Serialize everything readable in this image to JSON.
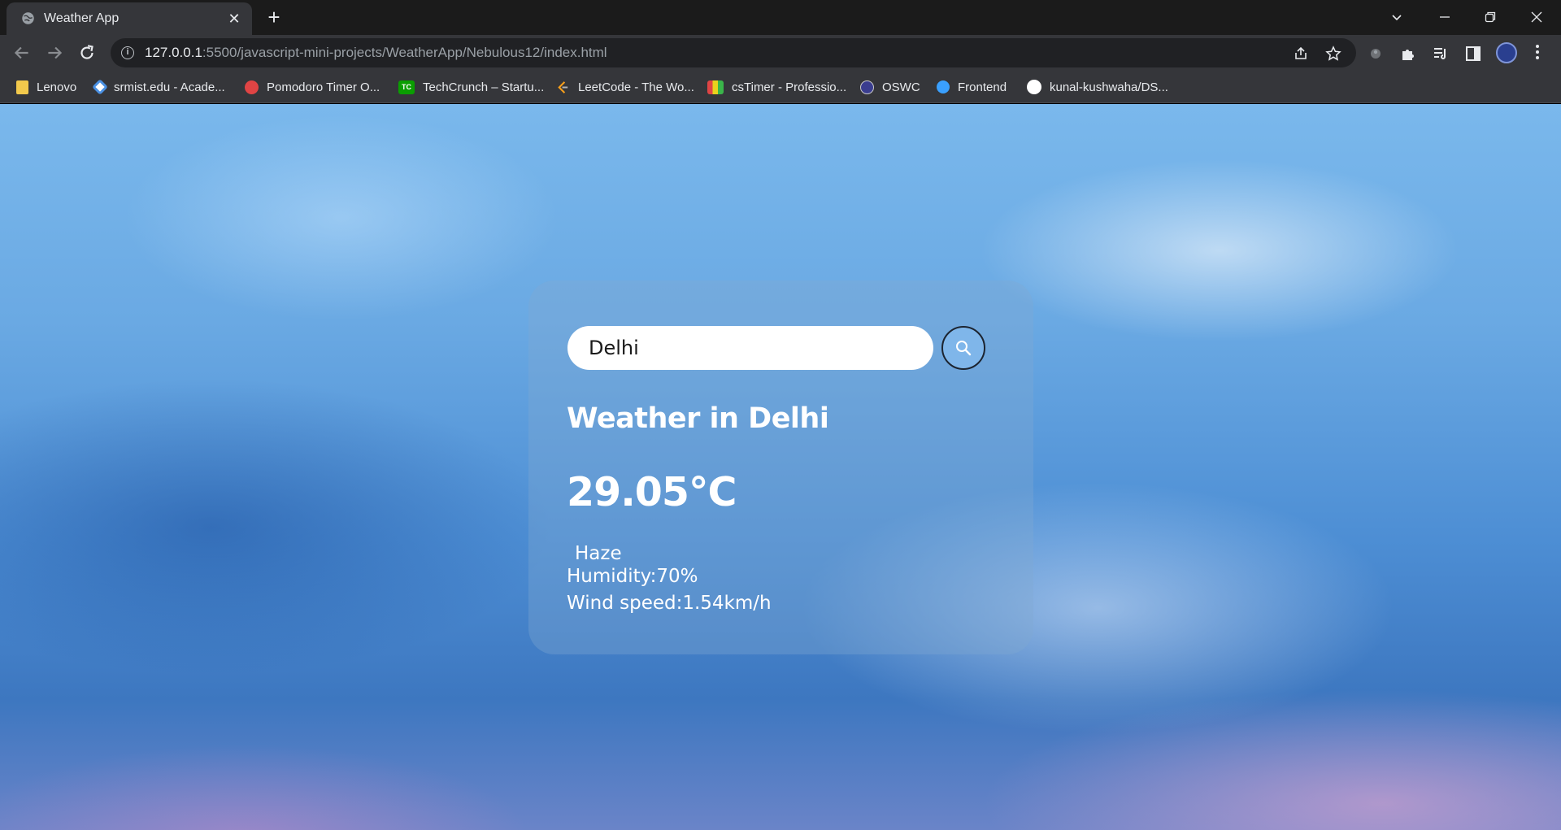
{
  "browser": {
    "tab": {
      "title": "Weather App",
      "favicon": "globe-icon"
    },
    "url": {
      "host": "127.0.0.1",
      "rest": ":5500/javascript-mini-projects/WeatherApp/Nebulous12/index.html"
    },
    "bookmarks": [
      {
        "label": "Lenovo",
        "icon": "folder-icon",
        "color": "#f2c94c"
      },
      {
        "label": "srmist.edu - Acade...",
        "icon": "srmist-icon",
        "color": "#4a90e2"
      },
      {
        "label": "Pomodoro Timer O...",
        "icon": "pomodoro-icon",
        "color": "#e04444"
      },
      {
        "label": "TechCrunch – Startu...",
        "icon": "techcrunch-icon",
        "color": "#0a9e01"
      },
      {
        "label": "LeetCode - The Wo...",
        "icon": "leetcode-icon",
        "color": "#f89f1b"
      },
      {
        "label": "csTimer - Professio...",
        "icon": "cstimer-icon",
        "color": "#e8d21d"
      },
      {
        "label": "OSWC",
        "icon": "oswc-icon",
        "color": "#3a3d8f"
      },
      {
        "label": "Frontend",
        "icon": "frontend-icon",
        "color": "#3aa0ff"
      },
      {
        "label": "kunal-kushwaha/DS...",
        "icon": "github-icon",
        "color": "#ffffff"
      }
    ]
  },
  "weather": {
    "search_value": "Delhi",
    "city_title": "Weather in Delhi",
    "temperature": "29.05°C",
    "description": "Haze",
    "humidity": "Humidity:70%",
    "wind": "Wind speed:1.54km/h"
  }
}
